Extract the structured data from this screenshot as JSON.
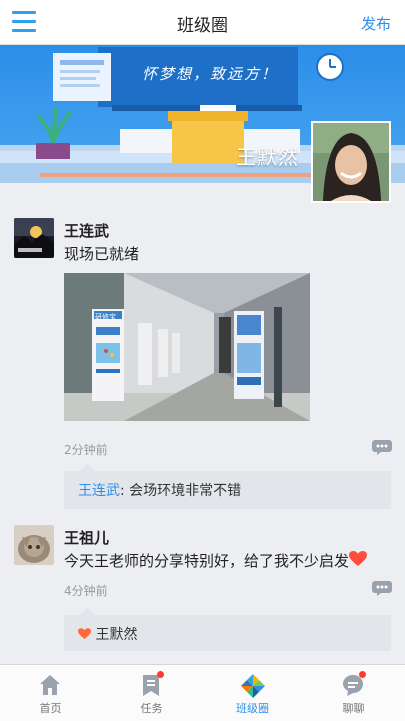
{
  "header": {
    "title": "班级圈",
    "publish_label": "发布",
    "menu_icon": "menu-icon"
  },
  "banner": {
    "slogan": "怀梦想，致远方！",
    "owner_name": "王默然"
  },
  "posts": [
    {
      "author": "王连武",
      "content": "现场已就绪",
      "time": "2分钟前",
      "comments": [
        {
          "author": "王连武",
          "separator": ": ",
          "text": "会场环境非常不错"
        }
      ],
      "poster_text": "研修宝"
    },
    {
      "author": "王祖儿",
      "content": "今天王老师的分享特别好，给了我不少启发",
      "time": "4分钟前",
      "likes": [
        "王默然"
      ]
    }
  ],
  "tabs": [
    {
      "label": "首页",
      "icon": "home-icon",
      "active": false,
      "badge": false
    },
    {
      "label": "任务",
      "icon": "bookmark-icon",
      "active": false,
      "badge": true
    },
    {
      "label": "班级圈",
      "icon": "pinwheel-icon",
      "active": true,
      "badge": false
    },
    {
      "label": "聊聊",
      "icon": "chat-bubble-icon",
      "active": false,
      "badge": true
    }
  ],
  "colors": {
    "accent": "#2f8fe8",
    "badge": "#ff3b30",
    "heart": "#ff4d3d"
  }
}
